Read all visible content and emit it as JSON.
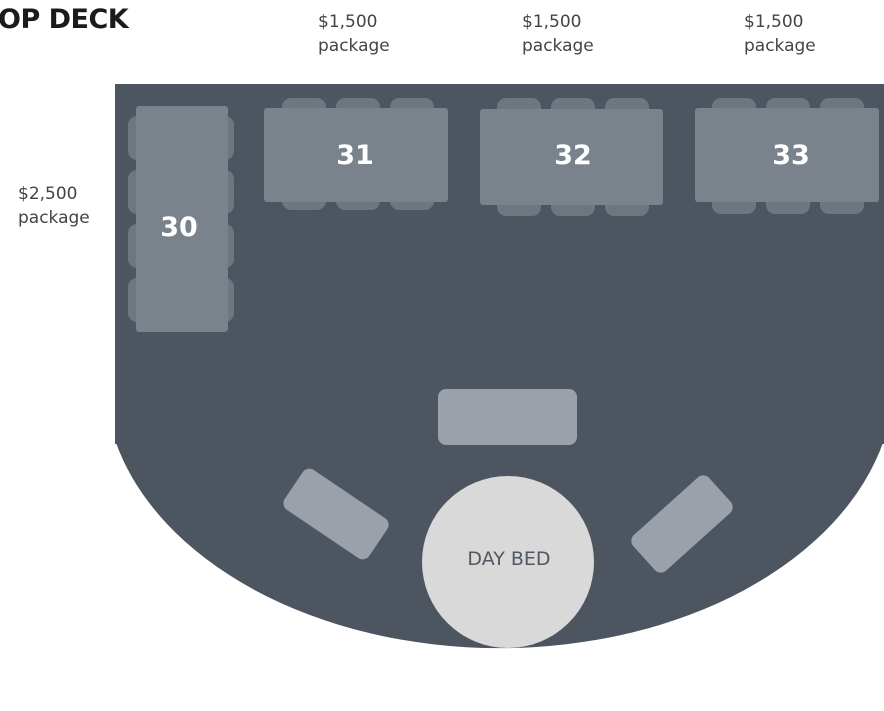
{
  "title": "OP DECK",
  "packages": {
    "table_30": {
      "price": "$2,500",
      "label": "package"
    },
    "table_31": {
      "price": "$1,500",
      "label": "package"
    },
    "table_32": {
      "price": "$1,500",
      "label": "package"
    },
    "table_33": {
      "price": "$1,500",
      "label": "package"
    }
  },
  "tables": {
    "t30": "30",
    "t31": "31",
    "t32": "32",
    "t33": "33"
  },
  "day_bed": {
    "label": "DAY BED"
  },
  "colors": {
    "deck": "#4c5560",
    "table": "#7a828b",
    "chair": "#6e767f",
    "lounge": "#9aa1aa",
    "day_bed": "#d9d9d9"
  }
}
